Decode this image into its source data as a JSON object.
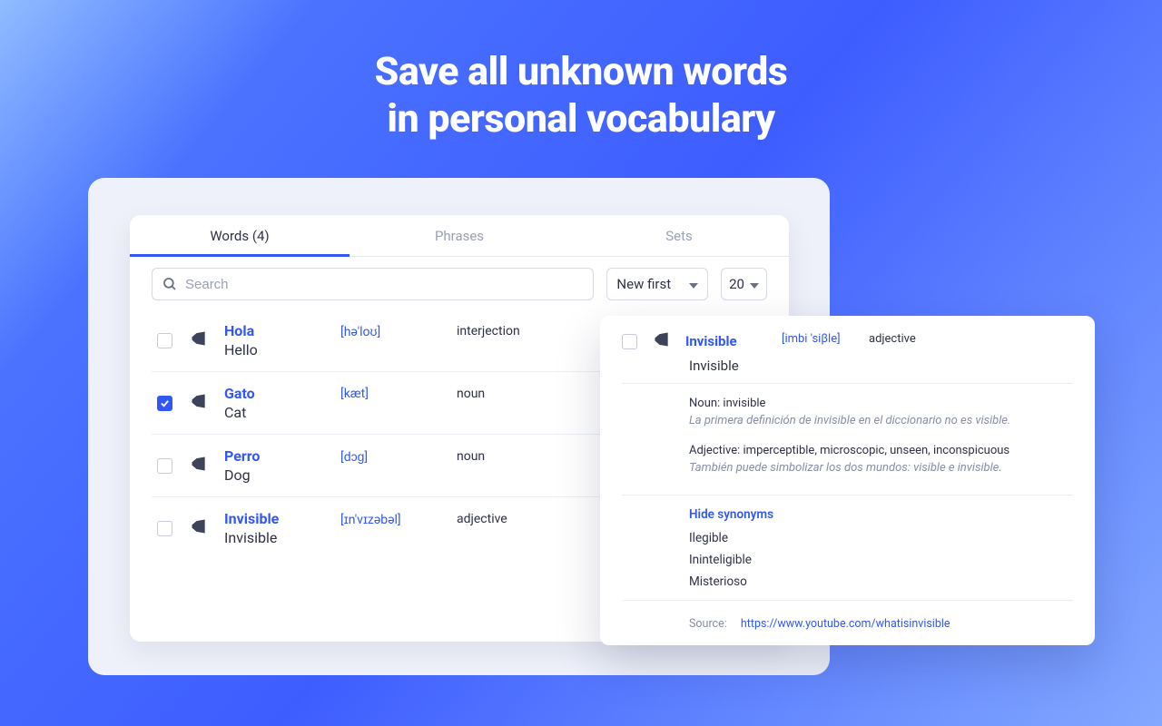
{
  "hero": {
    "line1": "Save all unknown words",
    "line2": "in personal vocabulary"
  },
  "tabs": {
    "words": "Words (4)",
    "phrases": "Phrases",
    "sets": "Sets"
  },
  "controls": {
    "search_placeholder": "Search",
    "sort_label": "New first",
    "page_size": "20"
  },
  "words": [
    {
      "word": "Hola",
      "translation": "Hello",
      "phonetic": "[hə'loʊ]",
      "pos": "interjection",
      "checked": false
    },
    {
      "word": "Gato",
      "translation": "Cat",
      "phonetic": "[kæt]",
      "pos": "noun",
      "checked": true
    },
    {
      "word": "Perro",
      "translation": "Dog",
      "phonetic": "[dɔɡ]",
      "pos": "noun",
      "checked": false
    },
    {
      "word": "Invisible",
      "translation": "Invisible",
      "phonetic": "[ɪn'vɪzəbəl]",
      "pos": "adjective",
      "checked": false
    }
  ],
  "popover": {
    "word": "Invisible",
    "translation": "Invisible",
    "phonetic": "[imbi 'siβle]",
    "pos": "adjective",
    "definitions": [
      {
        "title": "Noun: invisible",
        "example": "La primera definición de invisible en el diccionario no es visible."
      },
      {
        "title": "Adjective: imperceptible, microscopic, unseen, inconspicuous",
        "example": "También puede simbolizar los dos mundos: visible e invisible."
      }
    ],
    "synonyms_toggle": "Hide synonyms",
    "synonyms": [
      "Ilegible",
      "Ininteligible",
      "Misterioso"
    ],
    "source_label": "Source:",
    "source_url": "https://www.youtube.com/whatisinvisible"
  }
}
